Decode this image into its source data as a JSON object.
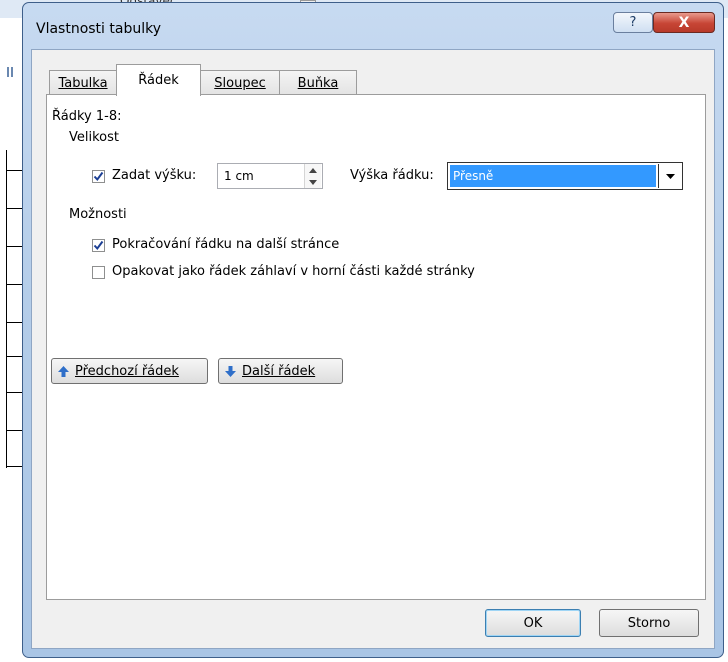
{
  "background": {
    "ribbon_text": "Odstavec"
  },
  "dialog": {
    "title": "Vlastnosti tabulky",
    "help_glyph": "?",
    "close_glyph": "X"
  },
  "tabs": [
    {
      "label": "Tabulka",
      "selected": false
    },
    {
      "label": "Řádek",
      "selected": true
    },
    {
      "label": "Sloupec",
      "selected": false
    },
    {
      "label": "Buňka",
      "selected": false
    }
  ],
  "row_tab": {
    "rows_label": "Řádky 1-8:",
    "size_label": "Velikost",
    "set_height": {
      "label": "Zadat výšku:",
      "checked": true
    },
    "height_value": "1 cm",
    "row_height_label": "Výška řádku:",
    "row_height_mode": "Přesně",
    "options_label": "Možnosti",
    "allow_break": {
      "label": "Pokračování řádku na další stránce",
      "checked": true
    },
    "repeat_header": {
      "label": "Opakovat jako řádek záhlaví v horní části každé stránky",
      "checked": false
    },
    "prev_row_button": "Předchozí řádek",
    "next_row_button": "Další řádek"
  },
  "footer": {
    "ok_label": "OK",
    "cancel_label": "Storno"
  },
  "colors": {
    "selection": "#3399ff",
    "close_button": "#c74535",
    "frame": "#b4cde9"
  }
}
